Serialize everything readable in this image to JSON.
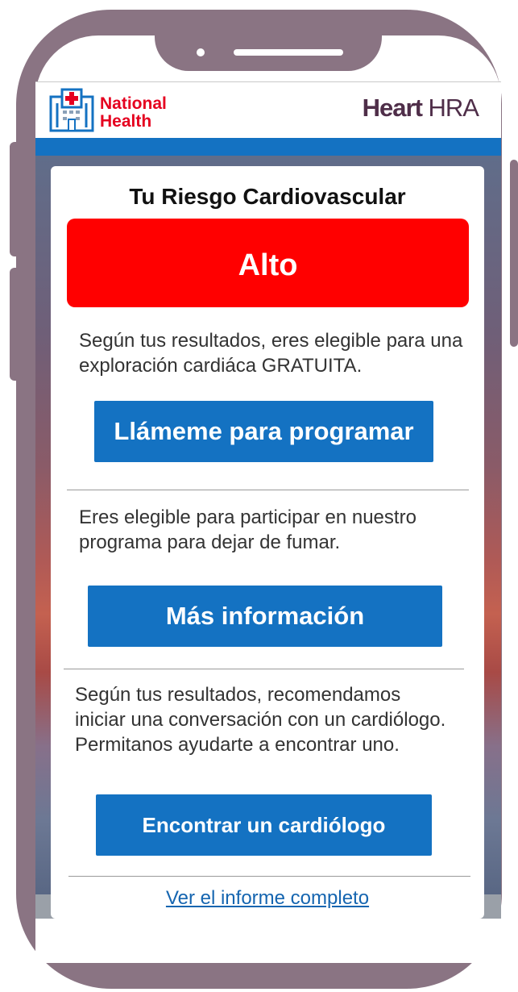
{
  "header": {
    "brand_line1": "National",
    "brand_line2": "Health",
    "app_bold": "Heart",
    "app_rest": " HRA"
  },
  "card": {
    "title": "Tu Riesgo Cardiovascular",
    "risk_level": "Alto",
    "section1_text": "Según tus resultados, eres elegible para una exploración cardiáca GRATUITA.",
    "section1_button": "Llámeme para programar",
    "section2_text": "Eres elegible para participar en nuestro programa para dejar de fumar.",
    "section2_button": "Más información",
    "section3_text": "Según tus resultados, recomendamos iniciar una conversación con un cardiólogo. Permitanos ayudarte a encontrar uno.",
    "section3_button": "Encontrar un cardiólogo",
    "report_link": "Ver el informe completo"
  },
  "colors": {
    "frame": "#8a7483",
    "brand_red": "#e5001f",
    "accent_blue": "#1472c2",
    "alert_red": "#ff0000",
    "app_title": "#4f2e49"
  },
  "icons": {
    "logo": "hospital-icon"
  }
}
